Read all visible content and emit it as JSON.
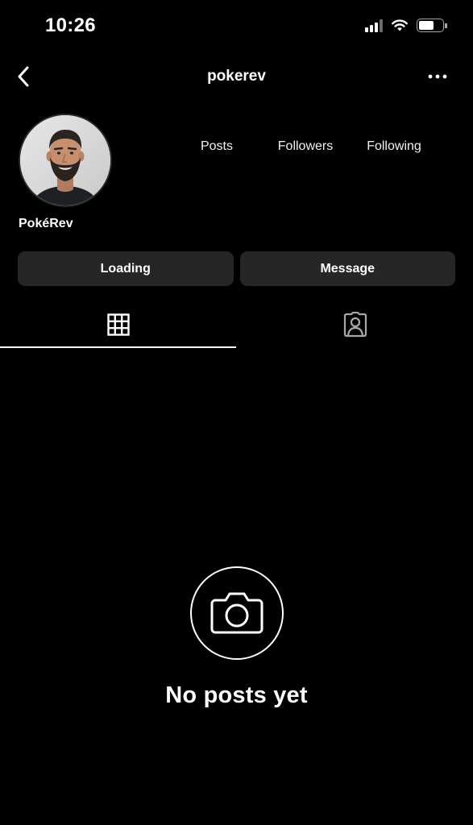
{
  "status_bar": {
    "time": "10:26",
    "icons": [
      "cellular-signal-icon",
      "wifi-icon",
      "battery-icon"
    ],
    "battery_level": 0.55
  },
  "nav": {
    "back_icon": "chevron-left-icon",
    "title": "pokerev",
    "more_icon": "ellipsis-icon"
  },
  "profile": {
    "display_name": "PokéRev",
    "avatar_icon": "profile-photo",
    "stats": [
      {
        "label": "Posts"
      },
      {
        "label": "Followers"
      },
      {
        "label": "Following"
      }
    ]
  },
  "actions": {
    "primary_label": "Loading",
    "secondary_label": "Message"
  },
  "tabs": [
    {
      "icon": "grid-icon",
      "selected": true
    },
    {
      "icon": "tagged-person-icon",
      "selected": false
    }
  ],
  "empty_state": {
    "icon": "camera-icon",
    "title": "No posts yet"
  },
  "colors": {
    "background": "#000000",
    "button_background": "#262626",
    "text": "#ffffff"
  }
}
